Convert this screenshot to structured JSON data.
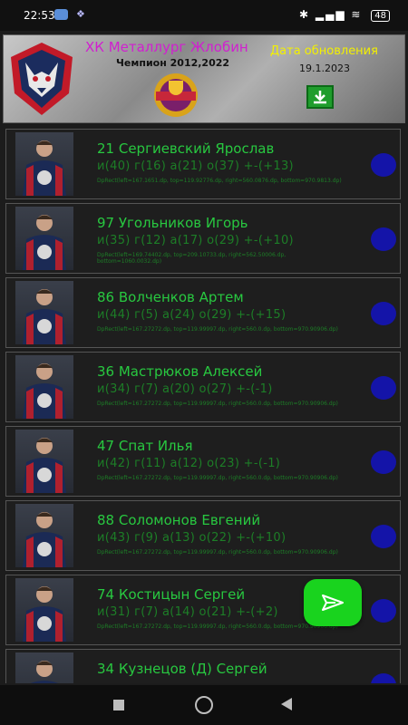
{
  "status_bar": {
    "time": "22:53",
    "icons": [
      "chat-icon",
      "notification-icon",
      "bluetooth-icon",
      "signal-icon",
      "wifi-icon",
      "battery-icon"
    ],
    "right_text": "✱ ▂▄▆ ≋",
    "battery": "48"
  },
  "header": {
    "title": "ХК Металлург Жлобин",
    "subtitle": "Чемпион 2012,2022",
    "update_label": "Дата обновления",
    "update_date": "19.1.2023",
    "title_color": "#d11fd0",
    "update_label_color": "#f3f000"
  },
  "players": [
    {
      "name": "21 Сергиевский Ярослав",
      "stats": "и(40)  г(16)  а(21)  о(37)  +-(+13)",
      "debug": "DpRect(left=167.1651.dp, top=119.92776.dp, right=560.0876.dp, bottom=970.9813.dp)"
    },
    {
      "name": "97 Угольников Игорь",
      "stats": "и(35)  г(12)  а(17)  о(29)  +-(+10)",
      "debug": "DpRect(left=169.74402.dp, top=209.10733.dp, right=562.50006.dp, bottom=1060.0032.dp)"
    },
    {
      "name": "86 Волченков Артем",
      "stats": "и(44)  г(5)  а(24)  о(29)  +-(+15)",
      "debug": "DpRect(left=167.27272.dp, top=119.99997.dp, right=560.0.dp, bottom=970.90906.dp)"
    },
    {
      "name": "36 Мастрюков Алексей",
      "stats": "и(34)  г(7)  а(20)  о(27)  +-(-1)",
      "debug": "DpRect(left=167.27272.dp, top=119.99997.dp, right=560.0.dp, bottom=970.90906.dp)"
    },
    {
      "name": "47 Спат Илья",
      "stats": "и(42)  г(11)  а(12)  о(23)  +-(-1)",
      "debug": "DpRect(left=167.27272.dp, top=119.99997.dp, right=560.0.dp, bottom=970.90906.dp)"
    },
    {
      "name": "88 Соломонов Евгений",
      "stats": "и(43)  г(9)  а(13)  о(22)  +-(+10)",
      "debug": "DpRect(left=167.27272.dp, top=119.99997.dp, right=560.0.dp, bottom=970.90906.dp)"
    },
    {
      "name": "74 Костицын Сергей",
      "stats": "и(31)  г(7)  а(14)  о(21)  +-(+2)",
      "debug": "DpRect(left=167.27272.dp, top=119.99997.dp, right=560.0.dp, bottom=970.90906.dp)"
    },
    {
      "name": "34 Кузнецов (Д) Сергей",
      "stats": "",
      "debug": ""
    }
  ],
  "colors": {
    "name": "#28c840",
    "stats": "#1d7e27",
    "fab": "#19d31e",
    "circle_button": "#1414a8"
  },
  "fab": {
    "icon": "send-icon"
  },
  "nav_bar": {
    "icons": [
      "recents-icon",
      "home-icon",
      "back-icon"
    ]
  }
}
